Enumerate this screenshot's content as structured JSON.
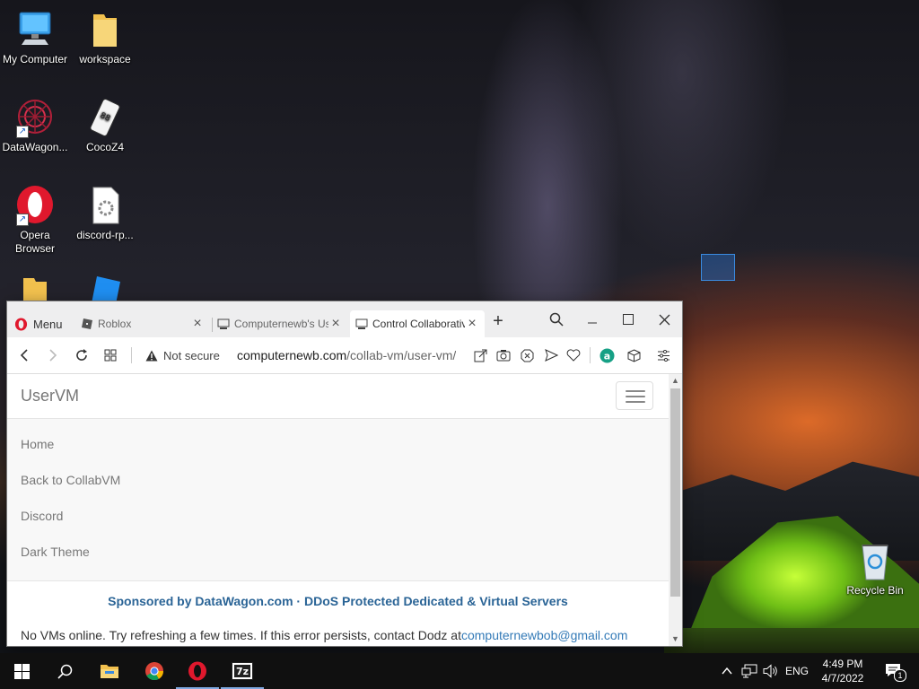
{
  "desktop": {
    "icons": [
      {
        "label": "My Computer",
        "icon": "computer-icon"
      },
      {
        "label": "workspace",
        "icon": "folder-icon"
      },
      {
        "label": "DataWagon...",
        "icon": "datawagon-icon"
      },
      {
        "label": "CocoZ4",
        "icon": "cocoz4-icon"
      },
      {
        "label": "Opera Browser",
        "icon": "opera-icon"
      },
      {
        "label": "discord-rp...",
        "icon": "file-gear-icon"
      },
      {
        "label": "",
        "icon": "folder-icon"
      },
      {
        "label": "",
        "icon": "roblox-studio-icon"
      },
      {
        "label": "Recycle Bin",
        "icon": "recycle-bin-icon"
      }
    ]
  },
  "browser": {
    "menu_label": "Menu",
    "tabs": [
      {
        "title": "Roblox",
        "active": false
      },
      {
        "title": "Computernewb's UserVM",
        "active": false
      },
      {
        "title": "Control Collaborative",
        "active": true
      }
    ],
    "address": {
      "security": "Not secure",
      "host": "computernewb.com",
      "path": "/collab-vm/user-vm/"
    }
  },
  "page": {
    "brand": "UserVM",
    "nav": [
      "Home",
      "Back to CollabVM",
      "Discord",
      "Dark Theme"
    ],
    "sponsor": "Sponsored by DataWagon.com · DDoS Protected Dedicated & Virtual Servers",
    "notice_text": "No VMs online. Try refreshing a few times. If this error persists, contact Dodz at",
    "notice_email": "computernewbob@gmail.com"
  },
  "taskbar": {
    "language": "ENG",
    "time": "4:49 PM",
    "date": "4/7/2022",
    "notification_count": "1"
  },
  "colors": {
    "accent": "#337ab7",
    "sponsor": "#2a6496",
    "opera_red": "#e0182d"
  }
}
